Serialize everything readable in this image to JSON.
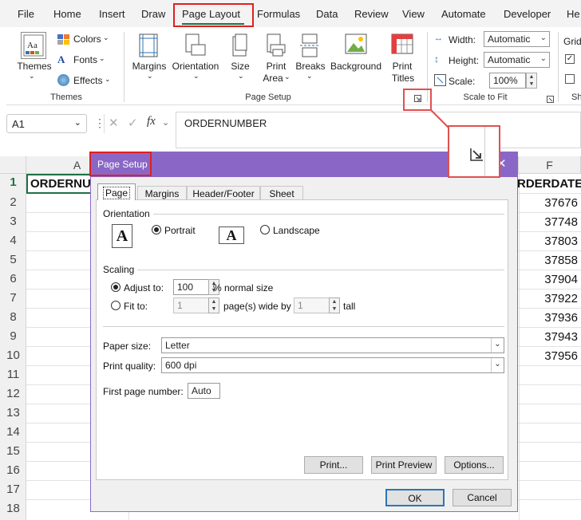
{
  "menu": {
    "tabs": [
      "File",
      "Home",
      "Insert",
      "Draw",
      "Page Layout",
      "Formulas",
      "Data",
      "Review",
      "View",
      "Automate",
      "Developer",
      "He"
    ],
    "active": "Page Layout"
  },
  "ribbon": {
    "themes": {
      "themes_label": "Themes",
      "colors": "Colors",
      "fonts": "Fonts",
      "effects": "Effects",
      "group": "Themes"
    },
    "page_setup": {
      "margins": "Margins",
      "orientation": "Orientation",
      "size": "Size",
      "print_area_1": "Print",
      "print_area_2": "Area",
      "breaks": "Breaks",
      "background": "Background",
      "print_titles_1": "Print",
      "print_titles_2": "Titles",
      "group": "Page Setup"
    },
    "scale_to_fit": {
      "width_label": "Width:",
      "width_value": "Automatic",
      "height_label": "Height:",
      "height_value": "Automatic",
      "scale_label": "Scale:",
      "scale_value": "100%",
      "group": "Scale to Fit"
    },
    "sheet_options": {
      "gridlines": "Grid",
      "group": "Sh"
    }
  },
  "formula_bar": {
    "name_box": "A1",
    "fx": "fx",
    "content": "ORDERNUMBER"
  },
  "sheet": {
    "col_a": "A",
    "col_f": "F",
    "a1": "ORDERNU",
    "f1": "RDERDATE",
    "rows": [
      "1",
      "2",
      "3",
      "4",
      "5",
      "6",
      "7",
      "8",
      "9",
      "10",
      "11",
      "12",
      "13",
      "14",
      "15",
      "16",
      "17",
      "18"
    ],
    "f_values": [
      "37676",
      "37748",
      "37803",
      "37858",
      "37904",
      "37922",
      "37936",
      "37943",
      "37956"
    ]
  },
  "dialog": {
    "title": "Page Setup",
    "tabs": [
      "Page",
      "Margins",
      "Header/Footer",
      "Sheet"
    ],
    "orientation_label": "Orientation",
    "portrait": "Portrait",
    "landscape": "Landscape",
    "scaling_label": "Scaling",
    "adjust_to": "Adjust to:",
    "adjust_value": "100",
    "normal_size": "% normal size",
    "fit_to": "Fit to:",
    "fit_wide": "1",
    "pages_wide_by": "page(s) wide by",
    "fit_tall": "1",
    "tall": "tall",
    "paper_size_label": "Paper size:",
    "paper_size": "Letter",
    "print_quality_label": "Print quality:",
    "print_quality": "600 dpi",
    "first_page_label": "First page number:",
    "first_page": "Auto",
    "print_btn": "Print...",
    "preview_btn": "Print Preview",
    "options_btn": "Options...",
    "ok": "OK",
    "cancel": "Cancel"
  },
  "colors": {
    "excel_green": "#1e7145",
    "dialog_purple": "#8a67c6",
    "highlight_red": "#e02020"
  }
}
